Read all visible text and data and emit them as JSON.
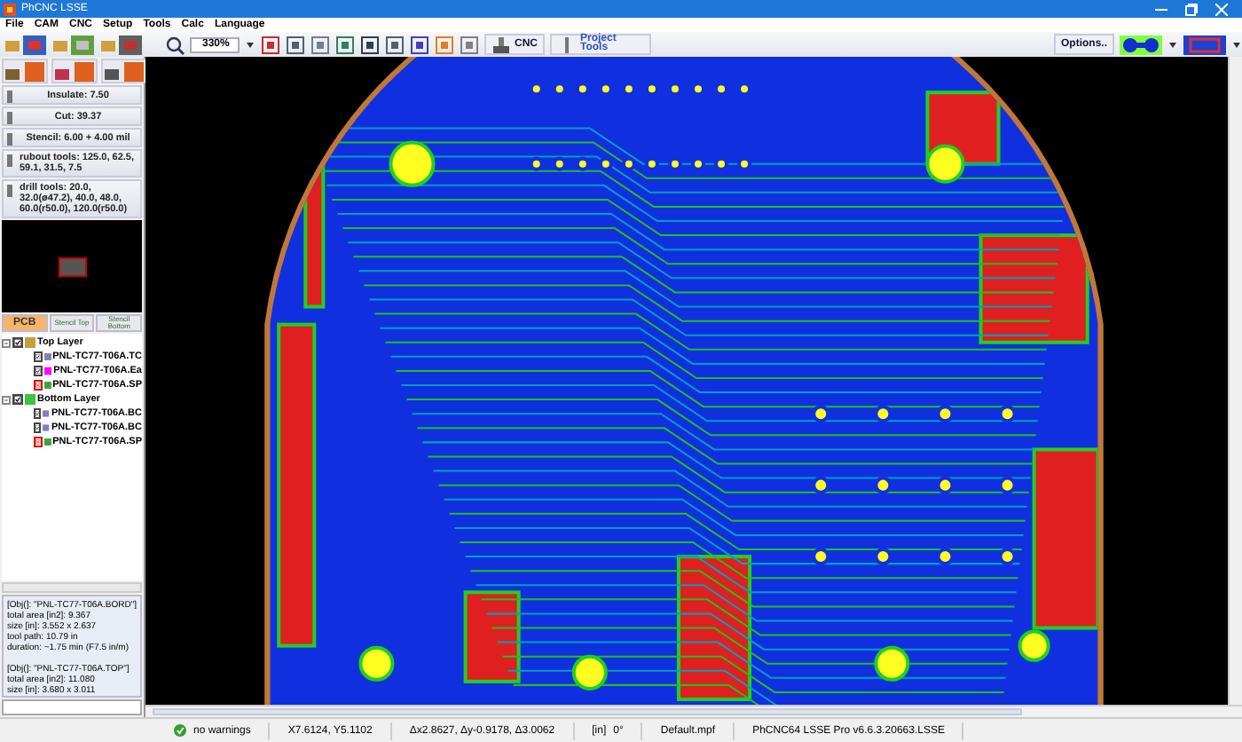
{
  "window": {
    "title": "PhCNC LSSE"
  },
  "menu": [
    "File",
    "CAM",
    "CNC",
    "Setup",
    "Tools",
    "Calc",
    "Language"
  ],
  "toolbar": {
    "zoom": "330%",
    "cnc_button": "CNC",
    "project_button": "Project Tools",
    "options_button": "Options.."
  },
  "tools": [
    {
      "label": "Insulate: 7.50"
    },
    {
      "label": "Cut: 39.37"
    },
    {
      "label": "Stencil: 6.00 + 4.00 mil"
    },
    {
      "label": "rubout tools: 125.0, 62.5, 59.1, 31.5, 7.5"
    },
    {
      "label": "drill tools: 20.0, 32.0(ø47.2), 40.0, 48.0, 60.0(r50.0), 120.0(r50.0)"
    }
  ],
  "tabs": [
    {
      "label": "PCB",
      "selected": true
    },
    {
      "label": "Stencil Top",
      "selected": false
    },
    {
      "label": "Stencil Bottom",
      "selected": false
    }
  ],
  "layers": [
    {
      "label": "Top Layer",
      "checked": true,
      "expanded": true,
      "children": [
        {
          "label": "PNL-TC77-T06A.TC",
          "checked": true,
          "color": "#8080c0"
        },
        {
          "label": "PNL-TC77-T06A.Ea",
          "checked": true,
          "color": "#ff00ff"
        },
        {
          "label": "PNL-TC77-T06A.SP",
          "checked": false,
          "color": "#40a040"
        }
      ]
    },
    {
      "label": "Bottom Layer",
      "checked": true,
      "expanded": true,
      "children": [
        {
          "label": "PNL-TC77-T06A.BC",
          "checked": true,
          "color": "#8080c0"
        },
        {
          "label": "PNL-TC77-T06A.BC",
          "checked": true,
          "color": "#8080c0"
        },
        {
          "label": "PNL-TC77-T06A.SP",
          "checked": false,
          "color": "#40a040"
        }
      ]
    }
  ],
  "info": [
    [
      "[Obj(]: \"PNL-TC77-T06A.BORD\"]",
      "total area [in2]: 9.367",
      "size [in]: 3.552 x 2.637",
      "tool path: 10.79 in",
      "duration: ~1.75 min (F7.5 in/m)"
    ],
    [
      "[Obj(]: \"PNL-TC77-T06A.TOP\"]",
      "total area [in2]: 11.080",
      "size [in]: 3.680 x 3.011"
    ]
  ],
  "status_bar": {
    "warnings": "no warnings",
    "position": "X7.6124, Y5.1102",
    "delta": "Δx2.8627, Δy-0.9178, Δ3.0062",
    "unit": "[in]",
    "angle": "0°",
    "file": "Default.mpf",
    "version": "PhCNC64 LSSE Pro v6.6.3.20663.LSSE"
  }
}
